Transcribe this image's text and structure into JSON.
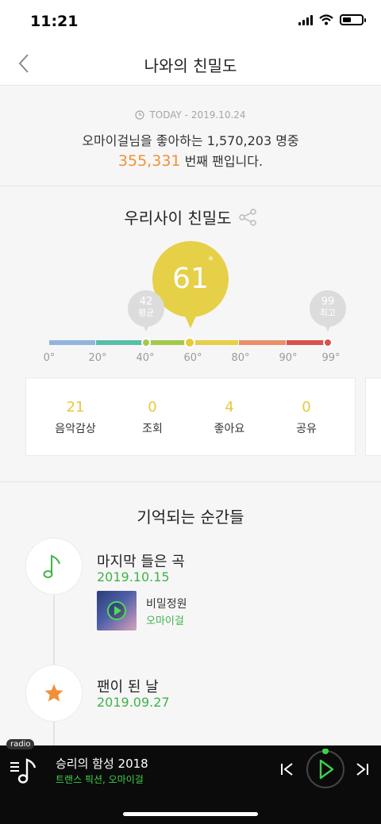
{
  "status_bar": {
    "time": "11:21"
  },
  "nav": {
    "title": "나와의 친밀도",
    "back_icon": "chevron-left-icon"
  },
  "rank": {
    "today_label": "TODAY - 2019.10.24",
    "line1": "오마이걸님을 좋아하는 1,570,203 명중",
    "rank_number": "355,331",
    "rank_suffix": " 번째 팬입니다."
  },
  "closeness": {
    "title": "우리사이 친밀도",
    "my_value": "61",
    "degree_symbol": "°",
    "average": {
      "value": "42",
      "label": "평균"
    },
    "max": {
      "value": "99",
      "label": "최고"
    },
    "ticks": [
      "0°",
      "20°",
      "40°",
      "60°",
      "80°",
      "90°",
      "99°"
    ],
    "scale_colors": [
      "#8fb4e0",
      "#56bfa8",
      "#a4c84a",
      "#e7cf46",
      "#e8906a",
      "#d9524a"
    ],
    "stats": [
      {
        "value": "21",
        "label": "음악감상"
      },
      {
        "value": "0",
        "label": "조회"
      },
      {
        "value": "4",
        "label": "좋아요"
      },
      {
        "value": "0",
        "label": "공유"
      }
    ]
  },
  "moments": {
    "title": "기억되는 순간들",
    "items": [
      {
        "heading": "마지막 들은 곡",
        "date": "2019.10.15",
        "song_title": "비밀정원",
        "song_artist": "오마이걸",
        "icon": "music-note-icon"
      },
      {
        "heading": "팬이 된 날",
        "date": "2019.09.27",
        "icon": "star-icon"
      }
    ]
  },
  "player": {
    "badge": "radio",
    "title": "승리의 함성 2018",
    "artist": "트랜스 픽션, 오마이걸"
  },
  "colors": {
    "accent_orange": "#f0913a",
    "accent_green": "#3fb34a",
    "gauge_yellow": "#e6d048"
  }
}
